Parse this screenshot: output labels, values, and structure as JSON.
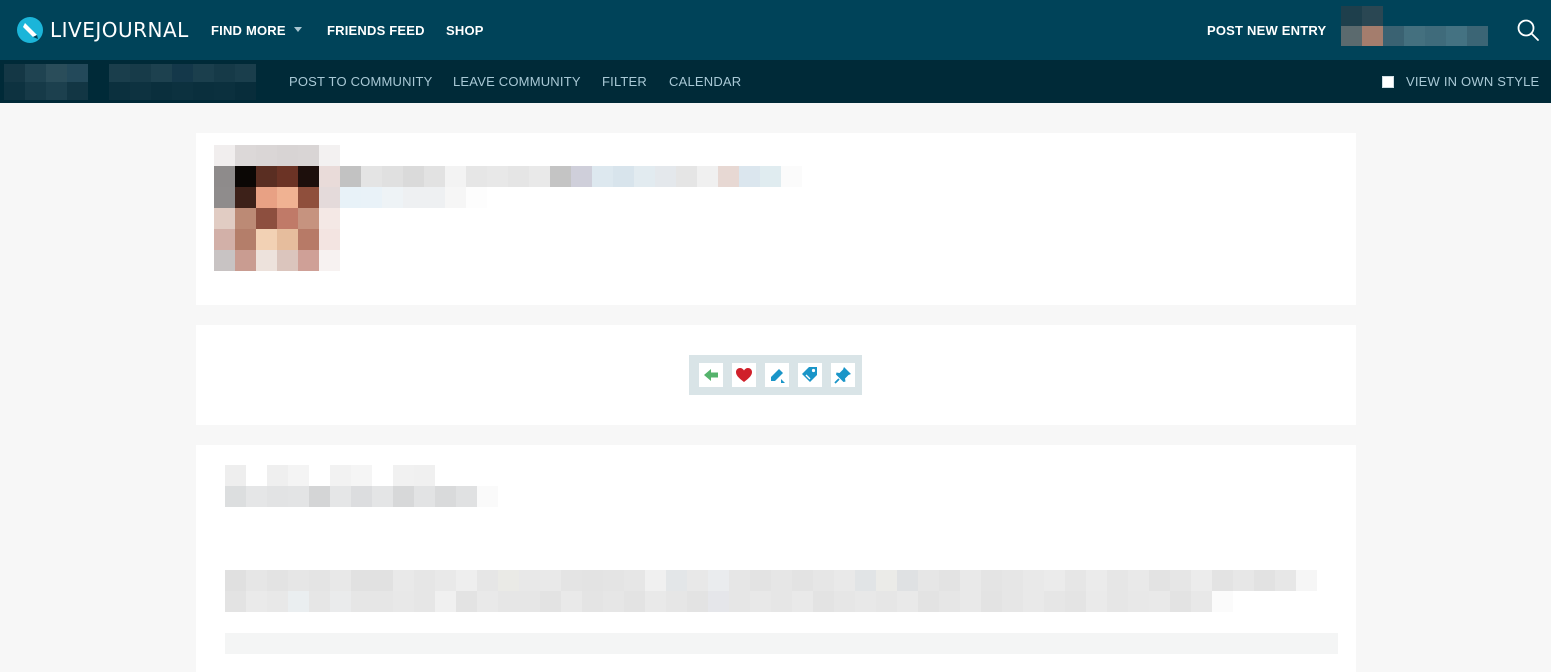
{
  "brand": {
    "name": "LIVEJOURNAL",
    "logo_icon": "livejournal-pencil-logo",
    "color": "#1bb5d9"
  },
  "header": {
    "nav": [
      {
        "label": "FIND MORE",
        "has_dropdown": true
      },
      {
        "label": "FRIENDS FEED"
      },
      {
        "label": "SHOP"
      }
    ],
    "post_new_entry": "POST NEW ENTRY",
    "search_icon": "search-icon",
    "background": "#004359"
  },
  "subnav": {
    "items": [
      {
        "label": "POST TO COMMUNITY"
      },
      {
        "label": "LEAVE COMMUNITY"
      },
      {
        "label": "FILTER"
      },
      {
        "label": "CALENDAR"
      }
    ],
    "view_in_own_style": {
      "label": "VIEW IN OWN STYLE",
      "checked": false
    },
    "background": "#002a38"
  },
  "entry_actions": [
    {
      "name": "reply",
      "icon": "arrow-left-icon",
      "color": "#55b36c"
    },
    {
      "name": "add-to-memories",
      "icon": "heart-icon",
      "color": "#d0202a"
    },
    {
      "name": "edit",
      "icon": "pencil-icon",
      "color": "#1a95c8"
    },
    {
      "name": "tags",
      "icon": "tag-icon",
      "color": "#1a95c8"
    },
    {
      "name": "pin",
      "icon": "pin-icon",
      "color": "#1a95c8"
    }
  ]
}
